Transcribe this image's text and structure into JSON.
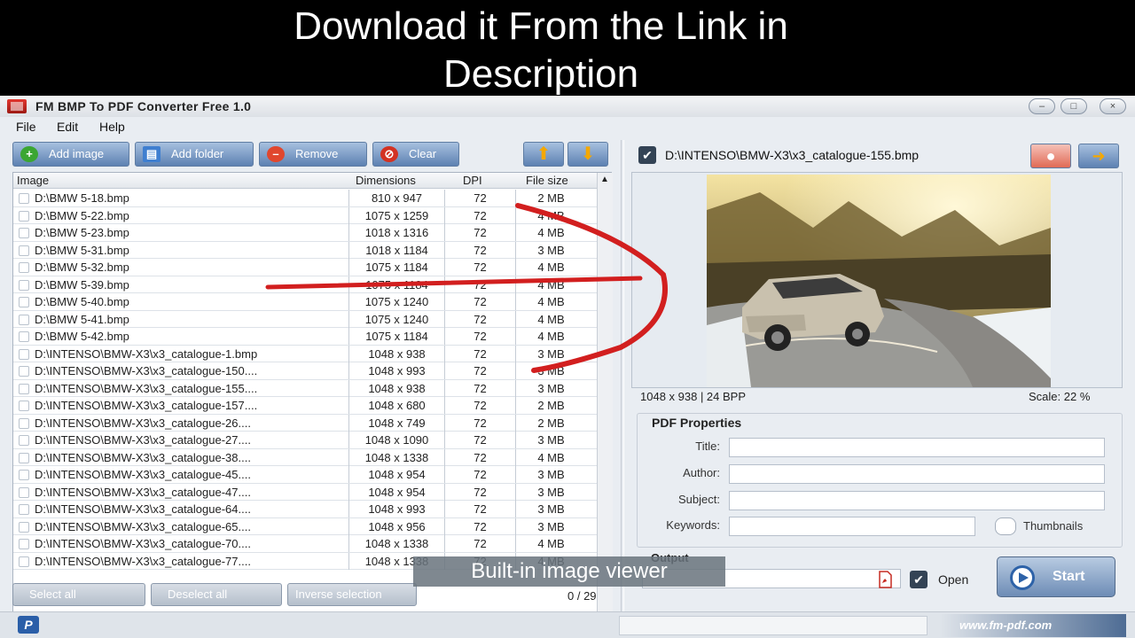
{
  "banner": {
    "line1": "Download it From the Link in",
    "line2": "Description"
  },
  "window": {
    "title": "FM BMP To PDF Converter Free 1.0",
    "controls": [
      "–",
      "□",
      "×"
    ]
  },
  "menu": [
    "File",
    "Edit",
    "Help"
  ],
  "toolbar": {
    "add_image": "Add image",
    "add_folder": "Add folder",
    "remove": "Remove",
    "clear": "Clear",
    "up_symbol": "⬆",
    "down_symbol": "⬇"
  },
  "table": {
    "headers": [
      "Image",
      "Dimensions",
      "DPI",
      "File size"
    ],
    "rows": [
      {
        "path": "D:\\BMW 5-18.bmp",
        "dim": "810 x 947",
        "dpi": "72",
        "size": "2 MB"
      },
      {
        "path": "D:\\BMW 5-22.bmp",
        "dim": "1075 x 1259",
        "dpi": "72",
        "size": "4 MB"
      },
      {
        "path": "D:\\BMW 5-23.bmp",
        "dim": "1018 x 1316",
        "dpi": "72",
        "size": "4 MB"
      },
      {
        "path": "D:\\BMW 5-31.bmp",
        "dim": "1018 x 1184",
        "dpi": "72",
        "size": "3 MB"
      },
      {
        "path": "D:\\BMW 5-32.bmp",
        "dim": "1075 x 1184",
        "dpi": "72",
        "size": "4 MB"
      },
      {
        "path": "D:\\BMW 5-39.bmp",
        "dim": "1075 x 1184",
        "dpi": "72",
        "size": "4 MB"
      },
      {
        "path": "D:\\BMW 5-40.bmp",
        "dim": "1075 x 1240",
        "dpi": "72",
        "size": "4 MB"
      },
      {
        "path": "D:\\BMW 5-41.bmp",
        "dim": "1075 x 1240",
        "dpi": "72",
        "size": "4 MB"
      },
      {
        "path": "D:\\BMW 5-42.bmp",
        "dim": "1075 x 1184",
        "dpi": "72",
        "size": "4 MB"
      },
      {
        "path": "D:\\INTENSO\\BMW-X3\\x3_catalogue-1.bmp",
        "dim": "1048 x 938",
        "dpi": "72",
        "size": "3 MB"
      },
      {
        "path": "D:\\INTENSO\\BMW-X3\\x3_catalogue-150....",
        "dim": "1048 x 993",
        "dpi": "72",
        "size": "3 MB"
      },
      {
        "path": "D:\\INTENSO\\BMW-X3\\x3_catalogue-155....",
        "dim": "1048 x 938",
        "dpi": "72",
        "size": "3 MB"
      },
      {
        "path": "D:\\INTENSO\\BMW-X3\\x3_catalogue-157....",
        "dim": "1048 x 680",
        "dpi": "72",
        "size": "2 MB"
      },
      {
        "path": "D:\\INTENSO\\BMW-X3\\x3_catalogue-26....",
        "dim": "1048 x 749",
        "dpi": "72",
        "size": "2 MB"
      },
      {
        "path": "D:\\INTENSO\\BMW-X3\\x3_catalogue-27....",
        "dim": "1048 x 1090",
        "dpi": "72",
        "size": "3 MB"
      },
      {
        "path": "D:\\INTENSO\\BMW-X3\\x3_catalogue-38....",
        "dim": "1048 x 1338",
        "dpi": "72",
        "size": "4 MB"
      },
      {
        "path": "D:\\INTENSO\\BMW-X3\\x3_catalogue-45....",
        "dim": "1048 x 954",
        "dpi": "72",
        "size": "3 MB"
      },
      {
        "path": "D:\\INTENSO\\BMW-X3\\x3_catalogue-47....",
        "dim": "1048 x 954",
        "dpi": "72",
        "size": "3 MB"
      },
      {
        "path": "D:\\INTENSO\\BMW-X3\\x3_catalogue-64....",
        "dim": "1048 x 993",
        "dpi": "72",
        "size": "3 MB"
      },
      {
        "path": "D:\\INTENSO\\BMW-X3\\x3_catalogue-65....",
        "dim": "1048 x 956",
        "dpi": "72",
        "size": "3 MB"
      },
      {
        "path": "D:\\INTENSO\\BMW-X3\\x3_catalogue-70....",
        "dim": "1048 x 1338",
        "dpi": "72",
        "size": "4 MB"
      },
      {
        "path": "D:\\INTENSO\\BMW-X3\\x3_catalogue-77....",
        "dim": "1048 x 1338",
        "dpi": "72",
        "size": "4 MB"
      }
    ]
  },
  "selection": {
    "select_all": "Select all",
    "deselect_all": "Deselect all",
    "inverse": "Inverse selection",
    "counter": "0 / 29"
  },
  "preview": {
    "path": "D:\\INTENSO\\BMW-X3\\x3_catalogue-155.bmp",
    "info": "1048 x 938  |  24 BPP",
    "scale": "Scale: 22 %",
    "checked": "✔",
    "next_symbol": "➜"
  },
  "pdf_properties": {
    "legend": "PDF Properties",
    "title_label": "Title:",
    "author_label": "Author:",
    "subject_label": "Subject:",
    "keywords_label": "Keywords:",
    "thumbnails_label": "Thumbnails"
  },
  "output": {
    "legend": "Output",
    "open_label": "Open",
    "start_label": "Start",
    "pdf_icon_glyph": "⬛"
  },
  "caption": "Built-in image viewer",
  "status": {
    "logo": "P",
    "url": "www.fm-pdf.com"
  }
}
